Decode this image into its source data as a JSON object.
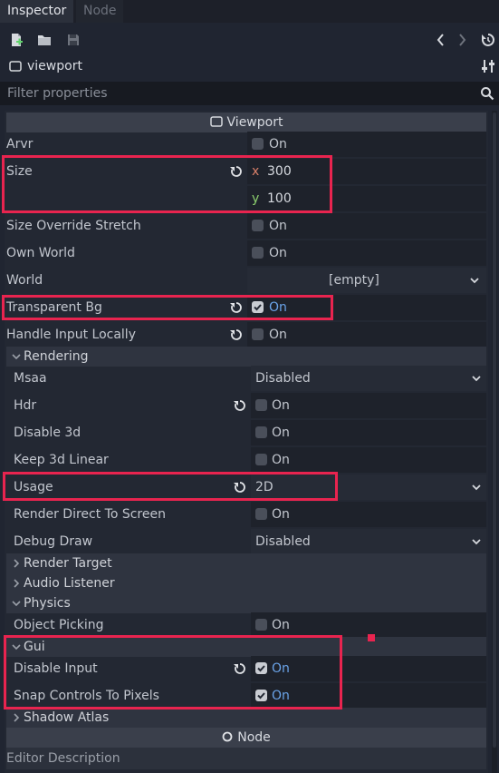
{
  "tabs": {
    "inspector": "Inspector",
    "node": "Node"
  },
  "object": {
    "name": "viewport"
  },
  "filter": {
    "placeholder": "Filter properties"
  },
  "sections": {
    "viewport": "Viewport",
    "rendering": "Rendering",
    "render_target": "Render Target",
    "audio_listener": "Audio Listener",
    "physics": "Physics",
    "gui": "Gui",
    "shadow_atlas": "Shadow Atlas",
    "node": "Node",
    "editor_description": "Editor Description"
  },
  "props": {
    "arvr": {
      "label": "Arvr",
      "value": "On",
      "checked": false
    },
    "size": {
      "label": "Size",
      "x_axis": "x",
      "x": "300",
      "y_axis": "y",
      "y": "100"
    },
    "size_override_stretch": {
      "label": "Size Override Stretch",
      "value": "On",
      "checked": false
    },
    "own_world": {
      "label": "Own World",
      "value": "On",
      "checked": false
    },
    "world": {
      "label": "World",
      "value": "[empty]"
    },
    "transparent_bg": {
      "label": "Transparent Bg",
      "value": "On",
      "checked": true
    },
    "handle_input_locally": {
      "label": "Handle Input Locally",
      "value": "On",
      "checked": false
    },
    "msaa": {
      "label": "Msaa",
      "value": "Disabled"
    },
    "hdr": {
      "label": "Hdr",
      "value": "On",
      "checked": false
    },
    "disable_3d": {
      "label": "Disable 3d",
      "value": "On",
      "checked": false
    },
    "keep_3d_linear": {
      "label": "Keep 3d Linear",
      "value": "On",
      "checked": false
    },
    "usage": {
      "label": "Usage",
      "value": "2D"
    },
    "render_direct_to_screen": {
      "label": "Render Direct To Screen",
      "value": "On",
      "checked": false
    },
    "debug_draw": {
      "label": "Debug Draw",
      "value": "Disabled"
    },
    "object_picking": {
      "label": "Object Picking",
      "value": "On",
      "checked": false
    },
    "disable_input": {
      "label": "Disable Input",
      "value": "On",
      "checked": true
    },
    "snap_controls_to_pixels": {
      "label": "Snap Controls To Pixels",
      "value": "On",
      "checked": true
    }
  },
  "colors": {
    "highlight": "#e8244f",
    "accent": "#6aa3e8"
  }
}
